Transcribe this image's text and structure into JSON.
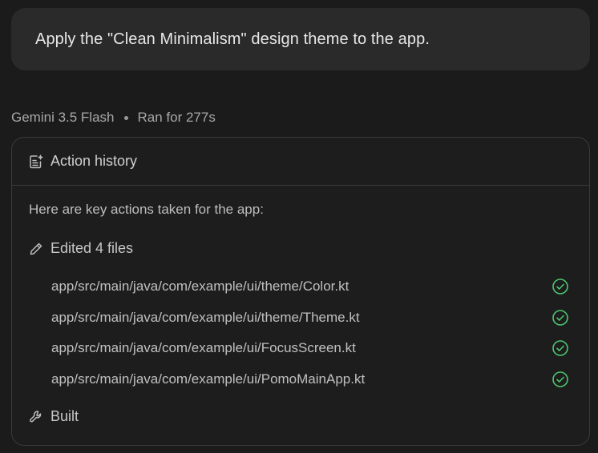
{
  "prompt": {
    "text": "Apply the \"Clean Minimalism\" design theme to the app."
  },
  "meta": {
    "model": "Gemini 3.5 Flash",
    "run_time": "Ran for 277s"
  },
  "history": {
    "title": "Action history",
    "title_icon": "notes-sparkle-icon",
    "intro": "Here are key actions taken for the app:",
    "edited": {
      "icon": "pencil-icon",
      "label": "Edited 4 files",
      "files": [
        {
          "path": "app/src/main/java/com/example/ui/theme/Color.kt",
          "status": "done"
        },
        {
          "path": "app/src/main/java/com/example/ui/theme/Theme.kt",
          "status": "done"
        },
        {
          "path": "app/src/main/java/com/example/ui/FocusScreen.kt",
          "status": "done"
        },
        {
          "path": "app/src/main/java/com/example/ui/PomoMainApp.kt",
          "status": "done"
        }
      ]
    },
    "built": {
      "icon": "wrench-icon",
      "label": "Built"
    }
  },
  "colors": {
    "background": "#1b1b1b",
    "bubble": "#2a2a2a",
    "border": "#3a3a3a",
    "success": "#4cc66e"
  }
}
